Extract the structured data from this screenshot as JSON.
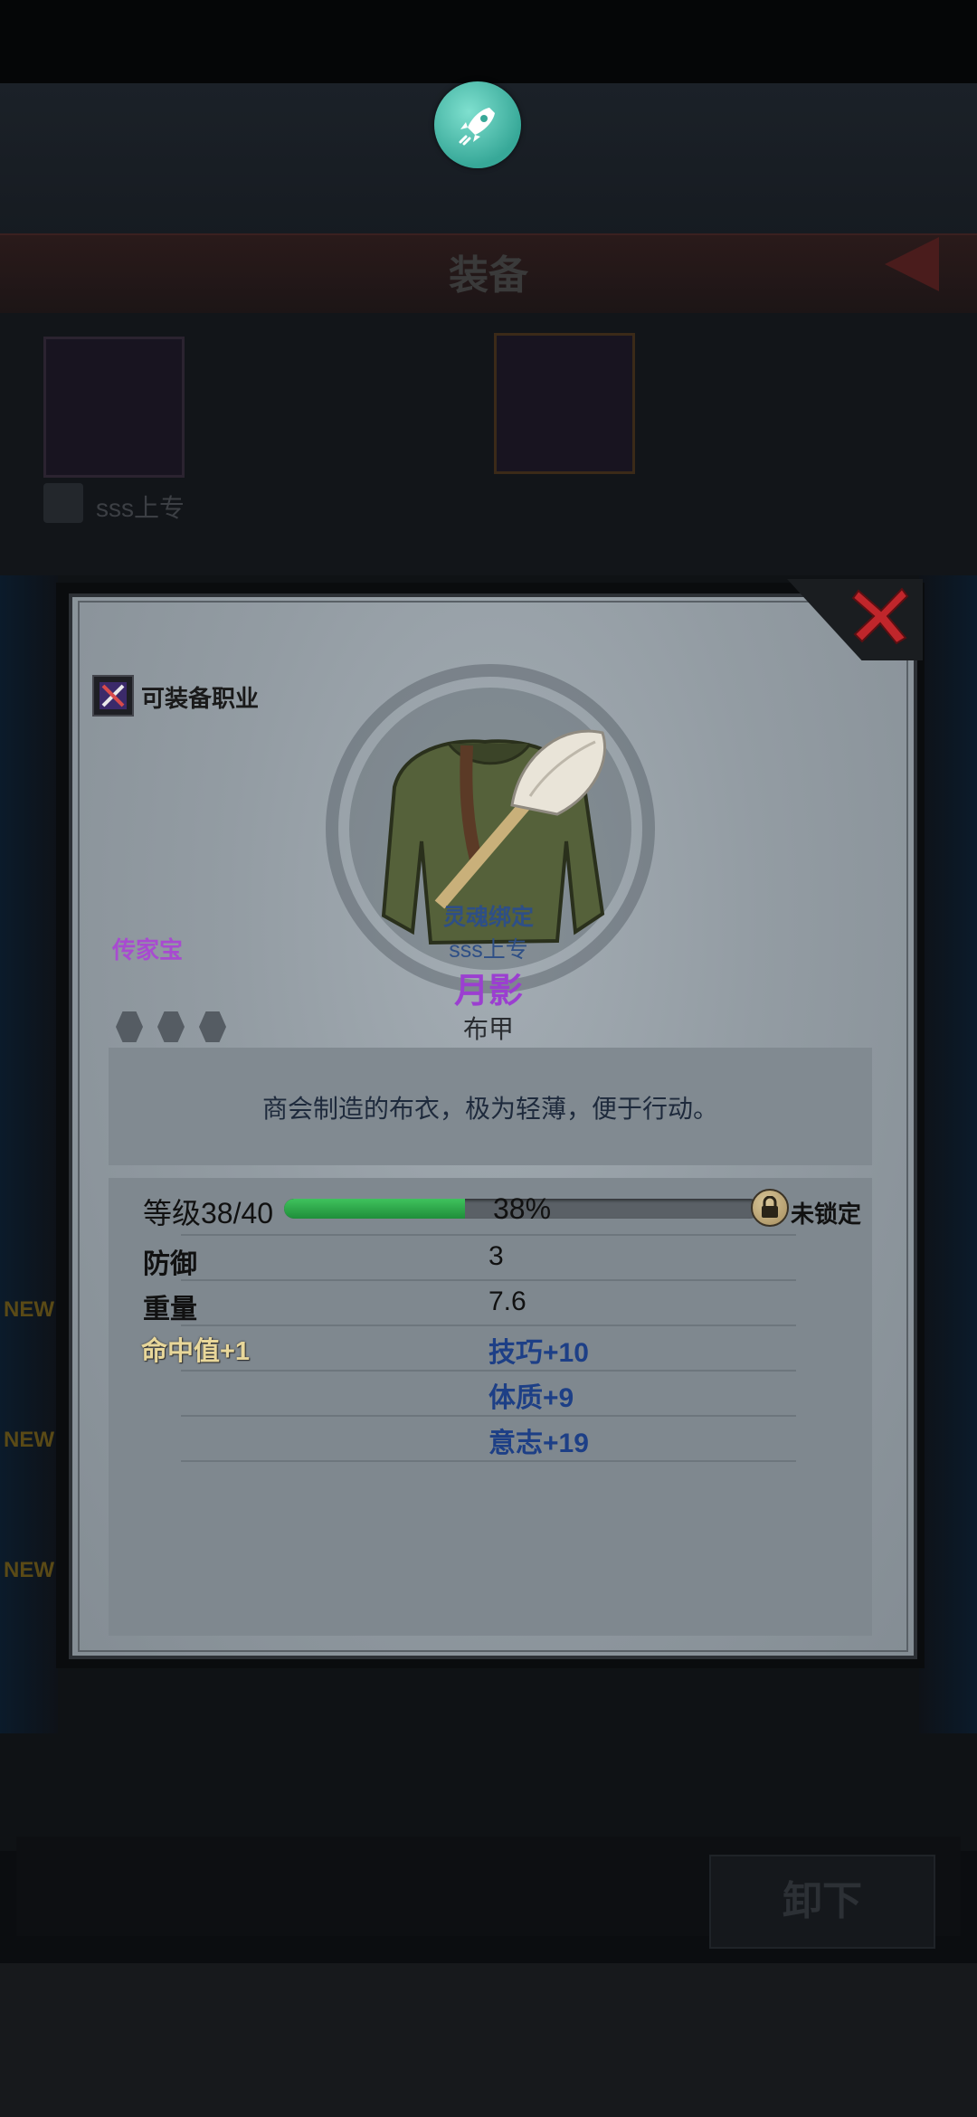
{
  "background": {
    "title": "装备",
    "slot_owner": "sss上专",
    "unequip_button": "卸下",
    "new_badge": "NEW"
  },
  "modal": {
    "class_label": "可装备职业",
    "quality": "传家宝",
    "binding": "灵魂绑定",
    "owner": "sss上专",
    "item_name": "月影",
    "item_type": "布甲",
    "description": "商会制造的布衣，极为轻薄，便于行动。",
    "level": {
      "label": "等级38/40",
      "percent_text": "38%",
      "progress": 0.38,
      "lock_label": "未锁定"
    },
    "stats": [
      {
        "label": "防御",
        "value": "3"
      },
      {
        "label": "重量",
        "value": "7.6"
      }
    ],
    "bonus_left": [
      "命中值+1"
    ],
    "bonus_right": [
      "技巧+10",
      "体质+9",
      "意志+19"
    ],
    "gem_slots": 3
  },
  "colors": {
    "quality": "#a84bd0",
    "binding": "#2e4f86",
    "progress": "#2fae4b",
    "close": "#c0262b"
  },
  "icons": {
    "top": "rocket-icon",
    "close": "close-icon",
    "class": "class-crossed-tools-icon",
    "lock": "padlock-icon",
    "item": "cloth-armor-icon"
  }
}
